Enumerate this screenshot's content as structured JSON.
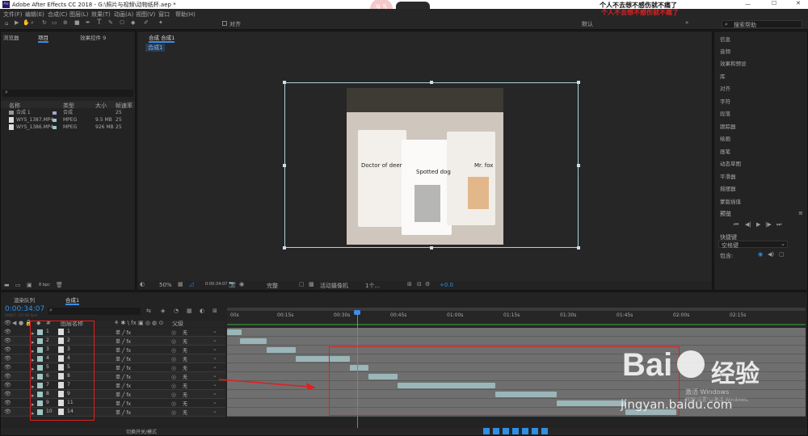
{
  "window": {
    "title": "Adobe After Effects CC 2018 - G:\\照片与视频\\动物纸杯.aep *",
    "app_icon": "Ae"
  },
  "badge": "9.5",
  "overlay": {
    "line1": "个人不去想不感伤就不痛了",
    "line2": "个人不去想不感伤就不痛了"
  },
  "menu": [
    "文件(F)",
    "编辑(E)",
    "合成(C)",
    "图层(L)",
    "效果(T)",
    "动画(A)",
    "视图(V)",
    "窗口",
    "帮助(H)"
  ],
  "toolbar": {
    "align_label": "对齐",
    "workspace": "默认",
    "search_placeholder": "搜索帮助"
  },
  "project_panel": {
    "tabs": [
      "浏览器",
      "项目",
      "效果控件 9"
    ],
    "columns": [
      "名称",
      "类型",
      "大小",
      "帧速率"
    ],
    "items": [
      {
        "name": "合成 1",
        "type": "合成",
        "size": "",
        "fps": "25"
      },
      {
        "name": "WYS_1387.MP4",
        "type": "MPEG",
        "size": "9.5 MB",
        "fps": "25"
      },
      {
        "name": "WYS_1386.MP4",
        "type": "MPEG",
        "size": "926 MB",
        "fps": "25"
      }
    ],
    "bpc": "8 bpc"
  },
  "comp_panel": {
    "tab": "合成 合成1",
    "breadcrumb": "合成1",
    "zoom": "50%",
    "timecode": "0:00:34:07",
    "quality": "完整",
    "camera": "活动摄像机",
    "views": "1个...",
    "exposure": "+0.0",
    "cup_labels": [
      "Doctor of deer",
      "Spotted dog",
      "Mr. fox"
    ]
  },
  "right_panel": {
    "items": [
      "信息",
      "音频",
      "效果和预设",
      "库",
      "对齐",
      "字符",
      "段落",
      "跟踪器",
      "绘画",
      "画笔",
      "动态草图",
      "平滑器",
      "摇摆器",
      "蒙版插值"
    ],
    "preview_title": "预览",
    "shortcut_label": "快捷键",
    "shortcut_value": "空格键",
    "include_label": "包含:"
  },
  "timeline": {
    "tabs": [
      "渲染队列",
      "合成1"
    ],
    "timecode": "0:00:34:07",
    "sub_timecode": "00857 (25.00 fps)",
    "col_layer_name": "图层名称",
    "col_parent": "父级",
    "ruler": [
      "00s",
      "00:15s",
      "00:30s",
      "00:45s",
      "01:00s",
      "01:15s",
      "01:30s",
      "01:45s",
      "02:00s",
      "02:15s"
    ],
    "layers": [
      {
        "num": "1",
        "name": "1",
        "parent": "无",
        "start": 0.0,
        "end": 0.04
      },
      {
        "num": "2",
        "name": "2",
        "parent": "无",
        "start": 0.035,
        "end": 0.11
      },
      {
        "num": "3",
        "name": "3",
        "parent": "无",
        "start": 0.11,
        "end": 0.19
      },
      {
        "num": "4",
        "name": "4",
        "parent": "无",
        "start": 0.19,
        "end": 0.34
      },
      {
        "num": "5",
        "name": "5",
        "parent": "无",
        "start": 0.34,
        "end": 0.39
      },
      {
        "num": "6",
        "name": "8",
        "parent": "无",
        "start": 0.39,
        "end": 0.47
      },
      {
        "num": "7",
        "name": "7",
        "parent": "无",
        "start": 0.47,
        "end": 0.74
      },
      {
        "num": "8",
        "name": "9",
        "parent": "无",
        "start": 0.74,
        "end": 0.91
      },
      {
        "num": "9",
        "name": "11",
        "parent": "无",
        "start": 0.91,
        "end": 1.1
      },
      {
        "num": "10",
        "name": "14",
        "parent": "无",
        "start": 1.1,
        "end": 1.24
      }
    ],
    "footer": "切换开关/模式"
  },
  "watermark": {
    "line1": "Bai",
    "line2": "经验",
    "url": "jingyan.baidu.com",
    "windows": "激活 Windows",
    "windows_sub": "转到\"设置\"以激活 Windows。"
  },
  "colors": {
    "accent": "#2f8fe3",
    "annotation": "#e02020",
    "bar": "#9bb6b8"
  }
}
